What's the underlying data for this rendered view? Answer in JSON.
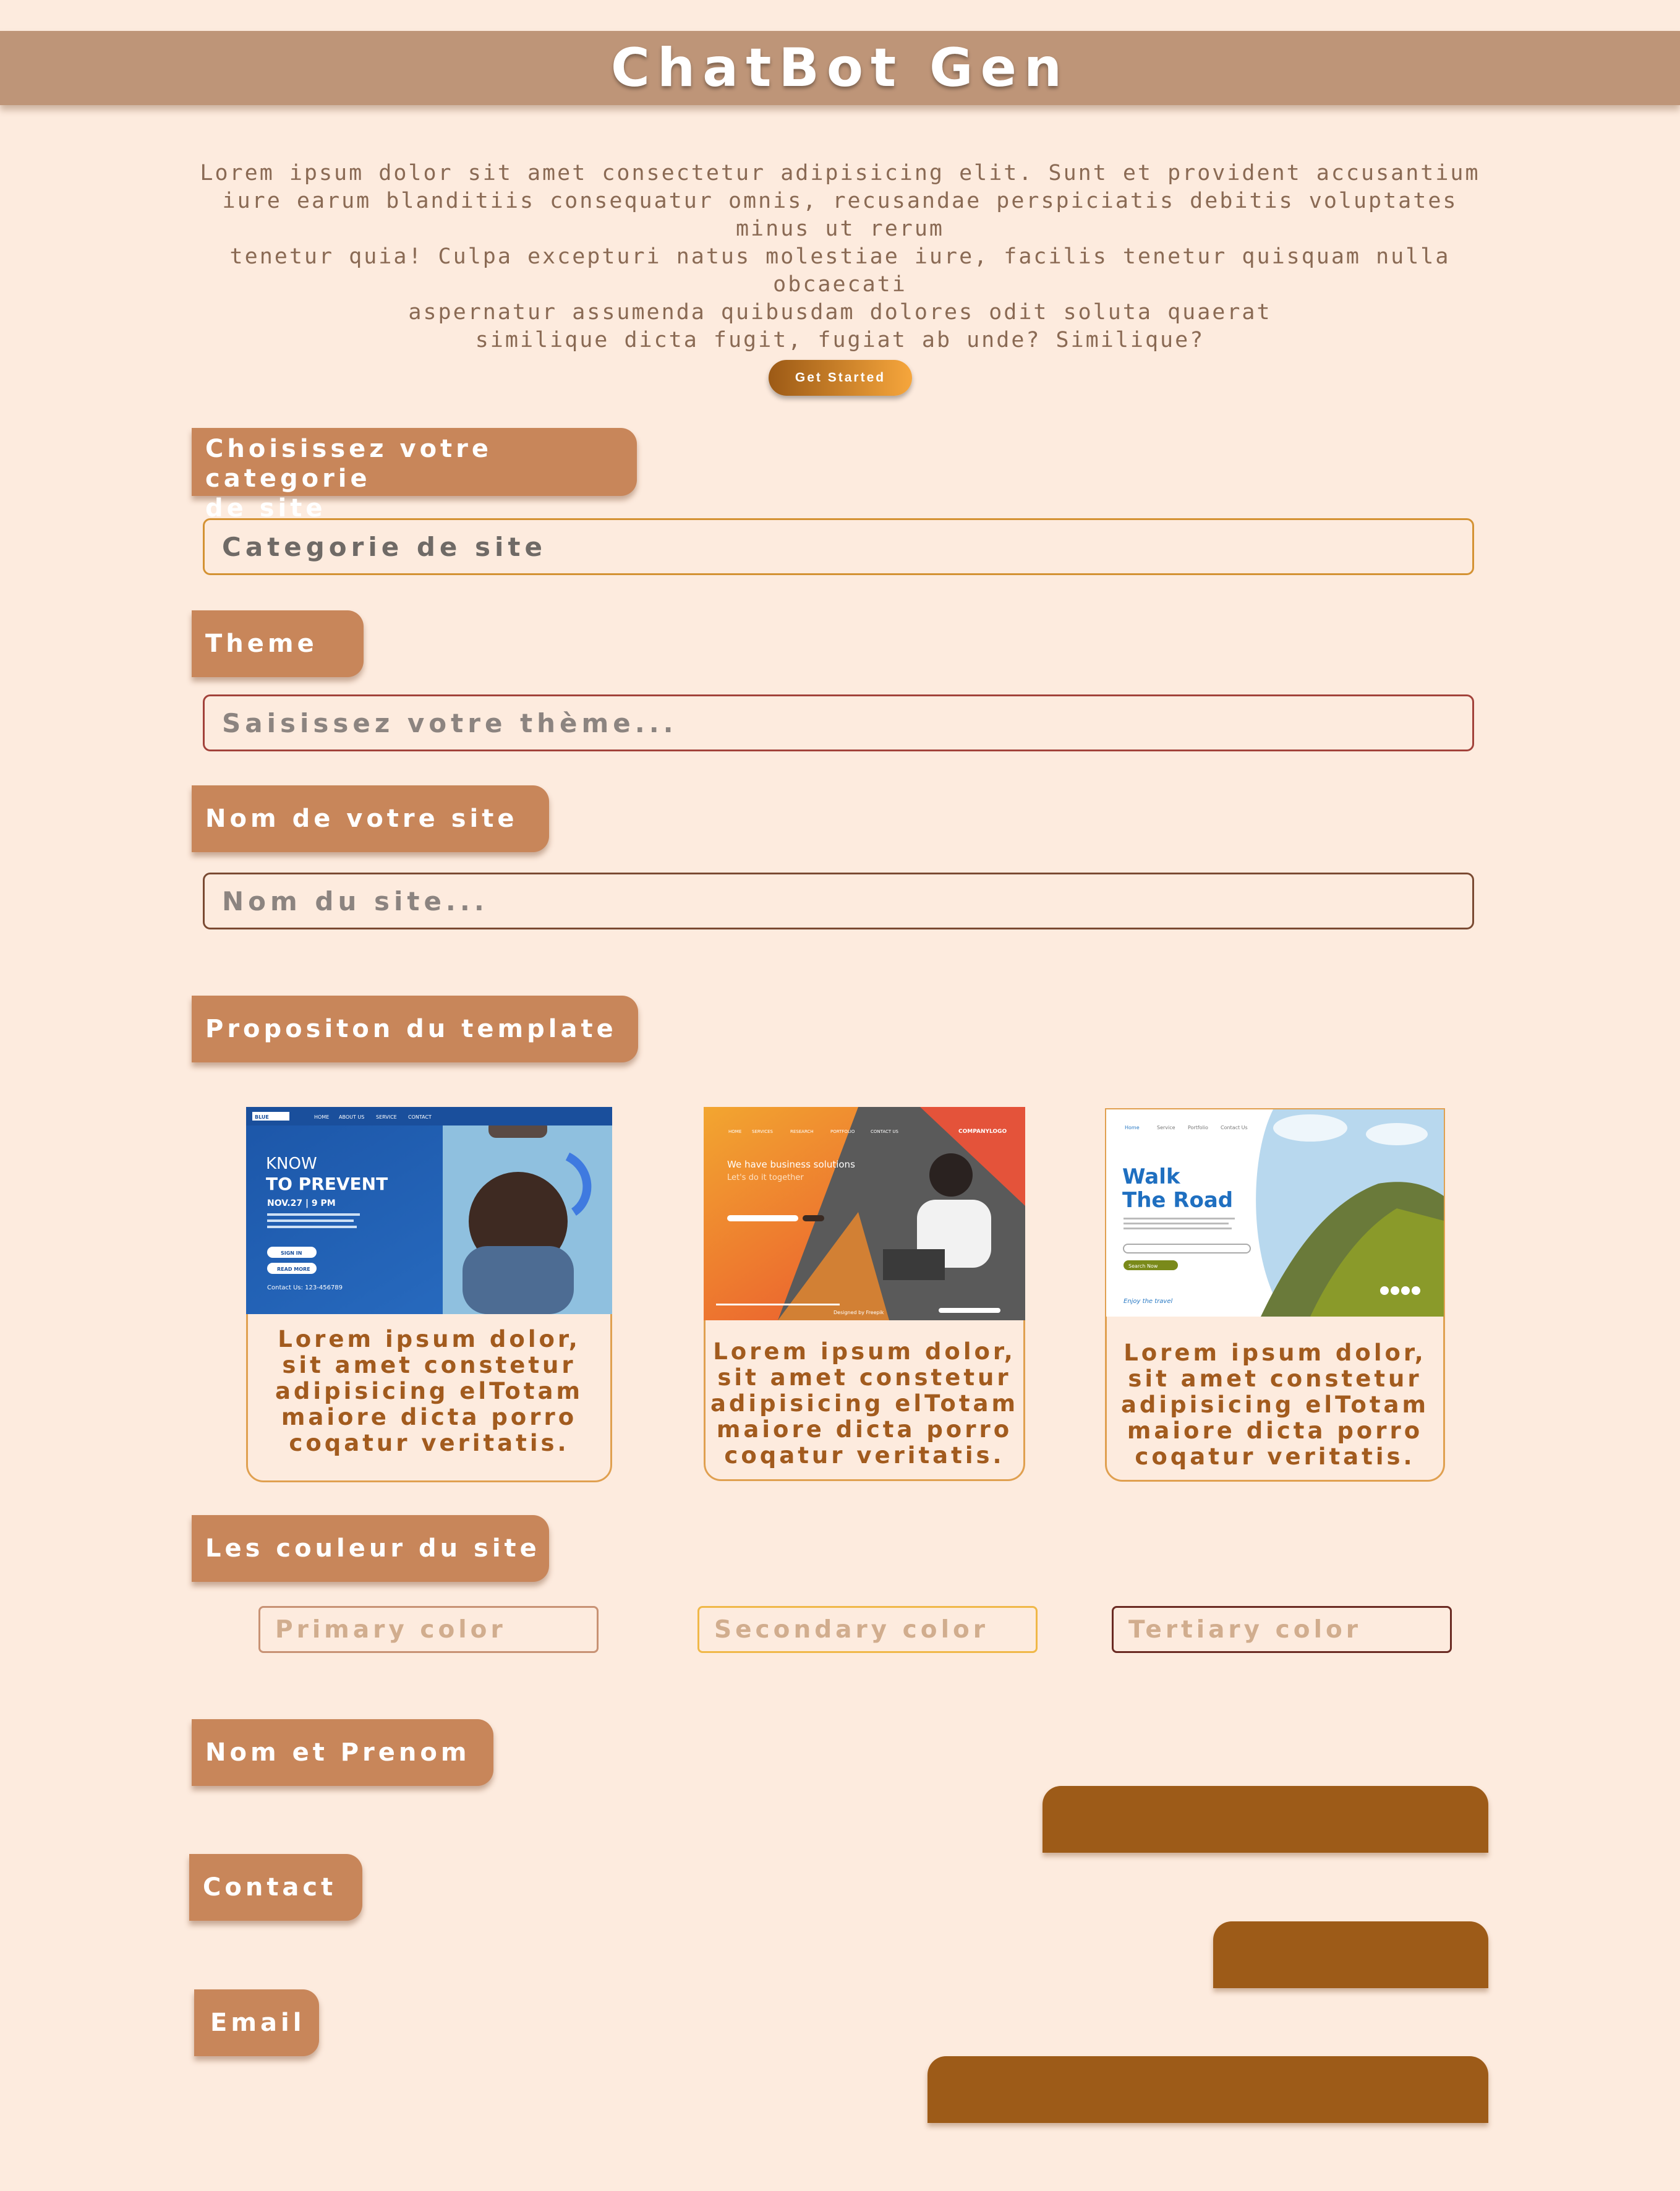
{
  "header": {
    "title": "ChatBot Gen"
  },
  "intro": {
    "lines": [
      "Lorem ipsum dolor sit amet consectetur adipisicing elit. Sunt et provident accusantium",
      "iure earum blanditiis consequatur omnis, recusandae perspiciatis debitis voluptates minus ut rerum",
      "tenetur quia! Culpa excepturi natus molestiae iure, facilis tenetur quisquam nulla obcaecati",
      "aspernatur assumenda quibusdam dolores odit soluta quaerat",
      "similique dicta fugit, fugiat ab unde? Similique?"
    ]
  },
  "cta": {
    "label": "Get Started"
  },
  "category": {
    "label_line1": "Choisissez votre categorie",
    "label_line2": "de site",
    "value": "Categorie de site"
  },
  "theme": {
    "label": "Theme",
    "placeholder": "Saisissez votre thème..."
  },
  "site_name": {
    "label": "Nom de votre site",
    "placeholder": "Nom du site..."
  },
  "templates": {
    "label": "Propositon du template",
    "cards": [
      {
        "image": {
          "brand": "BLUE",
          "nav": [
            "HOME",
            "ABOUT US",
            "SERVICE",
            "CONTACT"
          ],
          "title1": "KNOW",
          "title2": "TO PREVENT",
          "date": "NOV.27 | 9 PM",
          "body": "Lorem ipsum dolor sit amet, consectetur adipiscing elit. Nullam non tristique velit, eu tincidunt velit. Suspendisse interdum ex a dolor convallis scelerisque, eu pretium.",
          "btn1": "SIGN IN",
          "btn2": "READ MORE",
          "contact": "Contact Us: 123-456789"
        },
        "text": [
          "Lorem ipsum dolor,",
          "sit amet constetur",
          "adipisicing elTotam",
          "maiore dicta porro",
          "coqatur veritatis."
        ]
      },
      {
        "image": {
          "nav": [
            "HOME",
            "SERVICES",
            "RESEARCH",
            "PORTFOLIO",
            "CONTACT US"
          ],
          "logo": "COMPANYLOGO",
          "headline": "We have business solutions",
          "sub": "Let's do it together",
          "footer": "Designed by Freepik"
        },
        "text": [
          "Lorem ipsum dolor,",
          "sit amet constetur",
          "adipisicing elTotam",
          "maiore dicta porro",
          "coqatur veritatis."
        ]
      },
      {
        "image": {
          "nav": [
            "Home",
            "Service",
            "Portfolio",
            "Contact Us"
          ],
          "title1": "Walk",
          "title2": "The Road",
          "body": "Lorem ipsum dolor sit amet, consectetur adipiscing elit, sed do eiusmod tempor incididunt ut labore et dolore.",
          "btn": "Search Now",
          "tagline": "Enjoy the travel"
        },
        "text": [
          "Lorem ipsum dolor,",
          "sit amet constetur",
          "adipisicing elTotam",
          "maiore dicta porro",
          "coqatur veritatis."
        ]
      }
    ]
  },
  "colors": {
    "label": "Les couleur du site",
    "primary_placeholder": "Primary color",
    "secondary_placeholder": "Secondary color",
    "tertiary_placeholder": "Tertiary color"
  },
  "full_name": {
    "label": "Nom et Prenom"
  },
  "contact": {
    "label": "Contact"
  },
  "email": {
    "label": "Email"
  },
  "palette": {
    "background": "#fdebde",
    "header": "#be9578",
    "label": "#c8865a",
    "field": "#9d5b18",
    "accent": "#a25b1e"
  }
}
